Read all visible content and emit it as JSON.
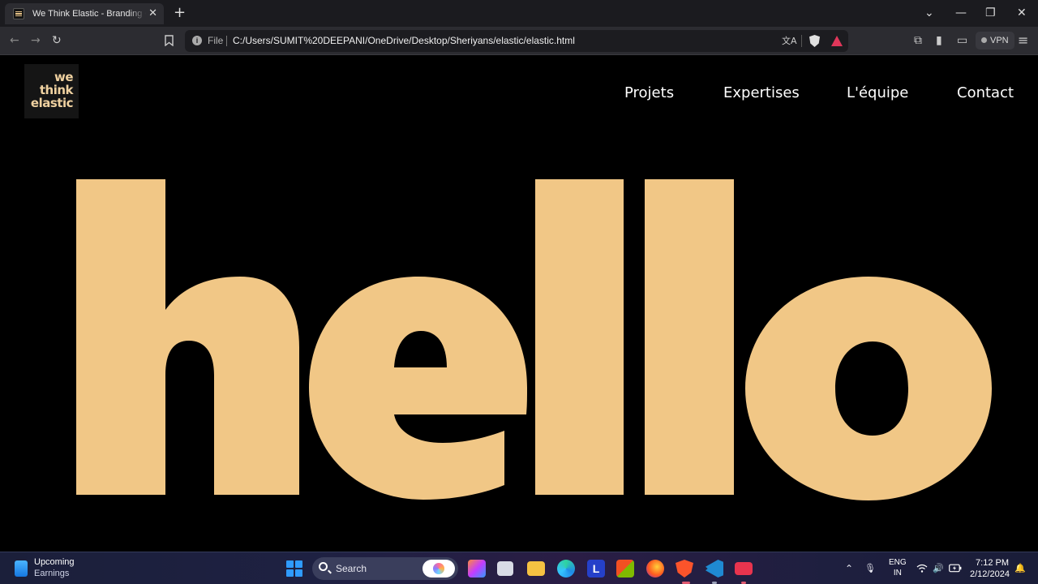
{
  "browser": {
    "tab_title": "We Think Elastic - Branding • Design",
    "tab_close": "✕",
    "new_tab": "+",
    "window_controls": {
      "minimize": "—",
      "maximize": "❐",
      "close": "✕",
      "tab_search": "⌄"
    },
    "nav": {
      "back": "←",
      "forward": "→",
      "reload": "↻"
    },
    "bookmark_icon": "bookmark-icon",
    "address": {
      "info": "i",
      "scheme_label": "File",
      "url": "C:/Users/SUMIT%20DEEPANI/OneDrive/Desktop/Sheriyans/elastic/elastic.html"
    },
    "translate_icon": "文A",
    "vpn_label": "VPN",
    "extensions_icon": "⧉",
    "sidebar_icon": "▮",
    "wallet_icon": "▭",
    "menu_icon": "≡"
  },
  "site": {
    "logo": {
      "line1": "we",
      "line2": "think",
      "line3": "elastic"
    },
    "nav": [
      "Projets",
      "Expertises",
      "L'équipe",
      "Contact"
    ],
    "hero_text": "hello",
    "colors": {
      "accent": "#f1c786",
      "background": "#000000",
      "nav_text": "#ffffff",
      "logo_text": "#efd1a0"
    }
  },
  "taskbar": {
    "widget_title": "Upcoming",
    "widget_subtitle": "Earnings",
    "search_label": "Search",
    "apps": [
      "copilot-icon",
      "microsoft-365-icon",
      "task-view-icon",
      "file-explorer-icon",
      "edge-icon",
      "l-app-icon",
      "microsoft-store-icon",
      "firefox-icon",
      "brave-icon",
      "vscode-icon",
      "recorder-icon"
    ],
    "tray": {
      "chevron": "⌃",
      "mic": "🎙",
      "lang_line1": "ENG",
      "lang_line2": "IN",
      "wifi": "wifi-icon",
      "volume": "🔊",
      "battery": "battery-icon",
      "bell": "🔔"
    },
    "time": "7:12 PM",
    "date": "2/12/2024"
  }
}
